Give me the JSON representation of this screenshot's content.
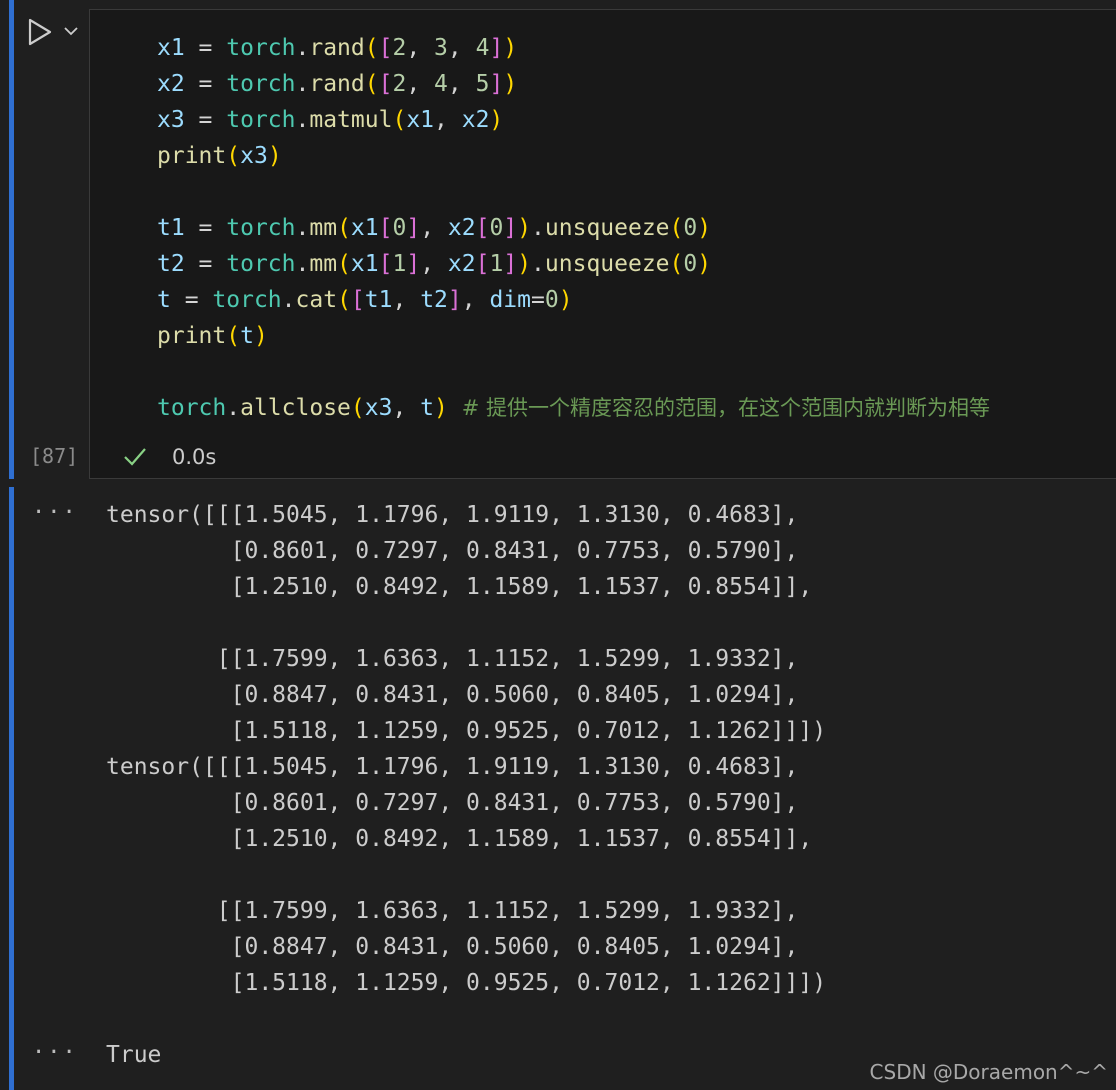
{
  "cell": {
    "execution_count": "[87]",
    "status_duration": "0.0s",
    "code_lines": [
      "x1 = torch.rand([2, 3, 4])",
      "x2 = torch.rand([2, 4, 5])",
      "x3 = torch.matmul(x1, x2)",
      "print(x3)",
      "",
      "t1 = torch.mm(x1[0], x2[0]).unsqueeze(0)",
      "t2 = torch.mm(x1[1], x2[1]).unsqueeze(0)",
      "t = torch.cat([t1, t2], dim=0)",
      "print(t)",
      "",
      "torch.allclose(x3, t) # 提供一个精度容忍的范围，在这个范围内就判断为相等"
    ]
  },
  "outputs": [
    {
      "menu_label": "···",
      "lines": [
        "tensor([[[1.5045, 1.1796, 1.9119, 1.3130, 0.4683],",
        "         [0.8601, 0.7297, 0.8431, 0.7753, 0.5790],",
        "         [1.2510, 0.8492, 1.1589, 1.1537, 0.8554]],",
        "",
        "        [[1.7599, 1.6363, 1.1152, 1.5299, 1.9332],",
        "         [0.8847, 0.8431, 0.5060, 0.8405, 1.0294],",
        "         [1.5118, 1.1259, 0.9525, 0.7012, 1.1262]]])",
        "tensor([[[1.5045, 1.1796, 1.9119, 1.3130, 0.4683],",
        "         [0.8601, 0.7297, 0.8431, 0.7753, 0.5790],",
        "         [1.2510, 0.8492, 1.1589, 1.1537, 0.8554]],",
        "",
        "        [[1.7599, 1.6363, 1.1152, 1.5299, 1.9332],",
        "         [0.8847, 0.8431, 0.5060, 0.8405, 1.0294],",
        "         [1.5118, 1.1259, 0.9525, 0.7012, 1.1262]]])"
      ]
    },
    {
      "menu_label": "···",
      "lines": [
        "True"
      ]
    }
  ],
  "watermark": "CSDN @Doraemon^~^",
  "icons": {
    "run": "play-icon",
    "run_menu": "chevron-down-icon",
    "status": "check-icon"
  },
  "colors": {
    "accent_bar": "#2f6fd1",
    "success_check": "#89d185"
  }
}
